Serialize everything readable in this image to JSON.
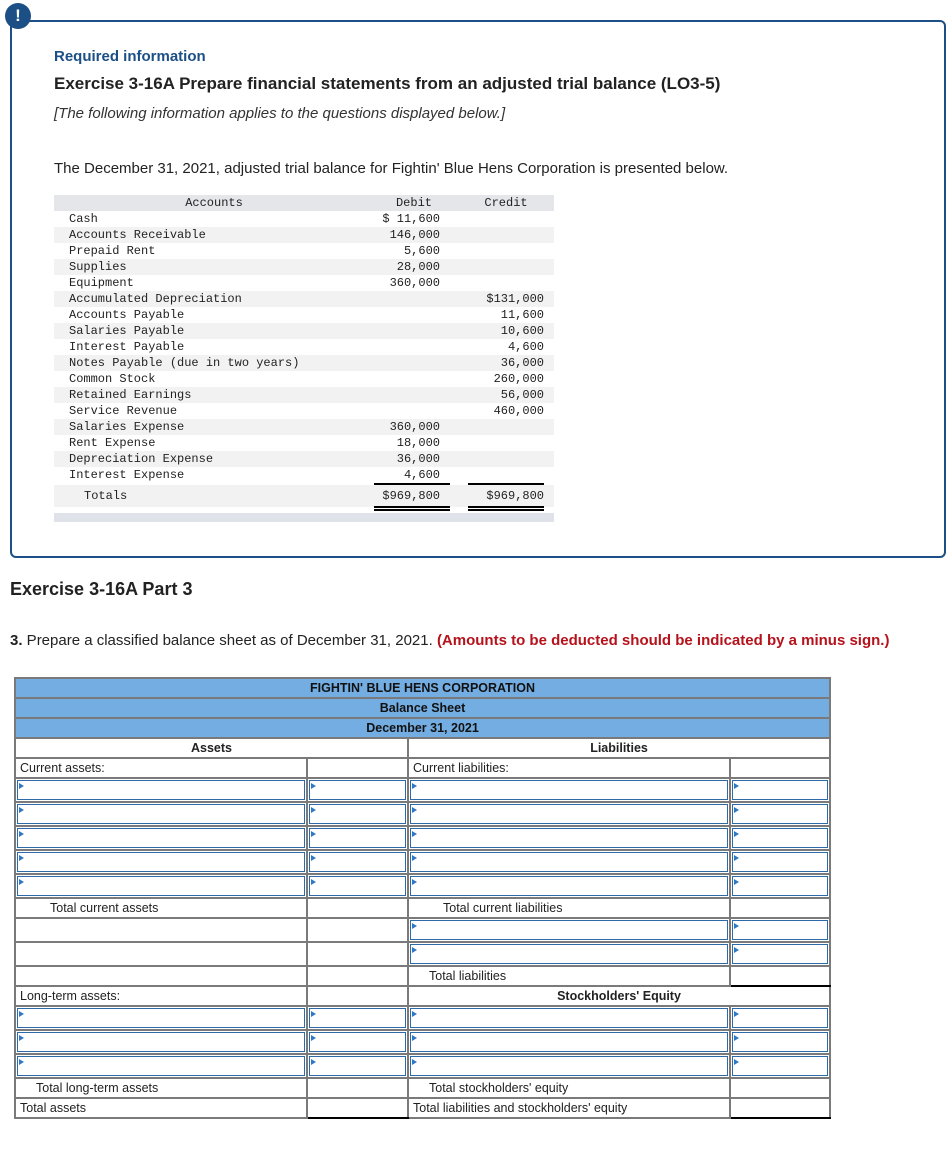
{
  "info": {
    "alert_icon": "!",
    "required_label": "Required information",
    "exercise_title": "Exercise 3-16A Prepare financial statements from an adjusted trial balance (LO3-5)",
    "note": "[The following information applies to the questions displayed below.]",
    "intro": "The December 31, 2021, adjusted trial balance for Fightin' Blue Hens Corporation is presented below."
  },
  "trial_balance": {
    "headers": {
      "accounts": "Accounts",
      "debit": "Debit",
      "credit": "Credit"
    },
    "rows": [
      {
        "account": "Cash",
        "debit": "$ 11,600",
        "credit": ""
      },
      {
        "account": "Accounts Receivable",
        "debit": "146,000",
        "credit": ""
      },
      {
        "account": "Prepaid Rent",
        "debit": "5,600",
        "credit": ""
      },
      {
        "account": "Supplies",
        "debit": "28,000",
        "credit": ""
      },
      {
        "account": "Equipment",
        "debit": "360,000",
        "credit": ""
      },
      {
        "account": "Accumulated Depreciation",
        "debit": "",
        "credit": "$131,000"
      },
      {
        "account": "Accounts Payable",
        "debit": "",
        "credit": "11,600"
      },
      {
        "account": "Salaries Payable",
        "debit": "",
        "credit": "10,600"
      },
      {
        "account": "Interest Payable",
        "debit": "",
        "credit": "4,600"
      },
      {
        "account": "Notes Payable (due in two years)",
        "debit": "",
        "credit": "36,000"
      },
      {
        "account": "Common Stock",
        "debit": "",
        "credit": "260,000"
      },
      {
        "account": "Retained Earnings",
        "debit": "",
        "credit": "56,000"
      },
      {
        "account": "Service Revenue",
        "debit": "",
        "credit": "460,000"
      },
      {
        "account": "Salaries Expense",
        "debit": "360,000",
        "credit": ""
      },
      {
        "account": "Rent Expense",
        "debit": "18,000",
        "credit": ""
      },
      {
        "account": "Depreciation Expense",
        "debit": "36,000",
        "credit": ""
      },
      {
        "account": "Interest Expense",
        "debit": "4,600",
        "credit": ""
      }
    ],
    "totals": {
      "label": "Totals",
      "debit": "$969,800",
      "credit": "$969,800"
    }
  },
  "part": {
    "title": "Exercise 3-16A Part 3",
    "number": "3.",
    "instruction": " Prepare a classified balance sheet as of December 31, 2021. ",
    "instruction_note": "(Amounts to be deducted should be indicated by a minus sign.)"
  },
  "balance_sheet": {
    "company": "FIGHTIN' BLUE HENS CORPORATION",
    "statement": "Balance Sheet",
    "date": "December 31, 2021",
    "assets_header": "Assets",
    "liabilities_header": "Liabilities",
    "current_assets_label": "Current assets:",
    "current_liabilities_label": "Current liabilities:",
    "total_current_assets": "Total current assets",
    "total_current_liabilities": "Total current liabilities",
    "total_liabilities": "Total liabilities",
    "long_term_assets_label": "Long-term assets:",
    "equity_header": "Stockholders' Equity",
    "total_long_term_assets": "Total long-term assets",
    "total_equity": "Total stockholders' equity",
    "total_assets": "Total assets",
    "total_liab_equity": "Total liabilities and stockholders' equity",
    "input_values": ""
  }
}
